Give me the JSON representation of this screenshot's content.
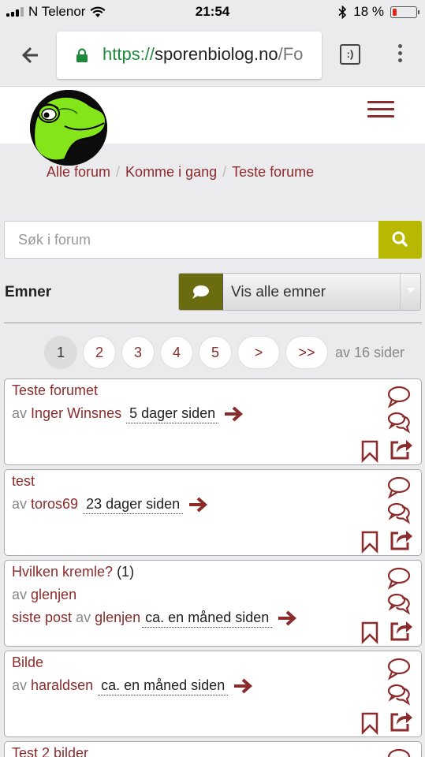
{
  "status": {
    "carrier": "N Telenor",
    "time": "21:54",
    "battery": "18 %",
    "battery_level": 0.18
  },
  "browser": {
    "url_protocol": "https://",
    "url_host": "sporenbiolog.no",
    "url_rest": "/Fo",
    "reader_icon": ":)"
  },
  "breadcrumb": [
    "Alle forum",
    "Komme i gang",
    "Teste forume"
  ],
  "search": {
    "placeholder": "Søk i forum"
  },
  "filter": {
    "label": "Emner",
    "value": "Vis alle emner"
  },
  "pagination": {
    "pages": [
      "1",
      "2",
      "3",
      "4",
      "5",
      ">",
      ">>"
    ],
    "active": "1",
    "total_text": "av 16 sider"
  },
  "topics": [
    {
      "title": "Teste forumet",
      "by_label": "av",
      "author": "Inger Winsnes",
      "when": "5 dager siden"
    },
    {
      "title": "test",
      "by_label": "av",
      "author": "toros69",
      "when": "23 dager siden"
    },
    {
      "title": "Hvilken kremle?",
      "count": "(1)",
      "by_label": "av",
      "author": "glenjen",
      "last_post_label": "siste post",
      "last_post_author": "glenjen",
      "when": "ca. en måned siden"
    },
    {
      "title": "Bilde",
      "by_label": "av",
      "author": "haraldsen",
      "when": "ca. en måned siden"
    },
    {
      "title": "Test 2 bilder"
    }
  ],
  "colors": {
    "accent": "#8b2b2b",
    "search_button": "#b8b800",
    "filter_icon_bg": "#6b6b10",
    "page_bg": "#ebebee"
  },
  "icons": [
    "back-arrow-icon",
    "lock-icon",
    "reader-mode-icon",
    "more-vert-icon",
    "menu-icon",
    "search-icon",
    "speech-bubble-icon",
    "comment-icon",
    "comments-icon",
    "bookmark-icon",
    "share-icon",
    "arrow-right-icon"
  ]
}
